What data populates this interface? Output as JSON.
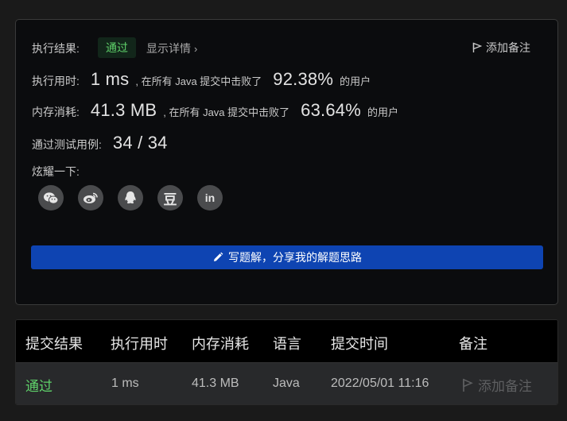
{
  "result": {
    "label": "执行结果:",
    "status": "通过",
    "detail_link": "显示详情",
    "add_note": "添加备注"
  },
  "runtime": {
    "label": "执行用时:",
    "value": "1 ms",
    "mid": ", 在所有 Java 提交中击败了",
    "percent": "92.38%",
    "suffix": "的用户"
  },
  "memory": {
    "label": "内存消耗:",
    "value": "41.3 MB",
    "mid": ", 在所有 Java 提交中击败了",
    "percent": "63.64%",
    "suffix": "的用户"
  },
  "tests": {
    "label": "通过测试用例:",
    "value": "34 / 34"
  },
  "share": {
    "label": "炫耀一下:",
    "icons": [
      "wechat-icon",
      "weibo-icon",
      "qq-icon",
      "douban-icon",
      "linkedin-icon"
    ],
    "douban_glyph": "豆",
    "linkedin_glyph": "in"
  },
  "write_button": "写题解，分享我的解题思路",
  "table": {
    "headers": [
      "提交结果",
      "执行用时",
      "内存消耗",
      "语言",
      "提交时间",
      "备注"
    ],
    "row": {
      "result": "通过",
      "runtime": "1 ms",
      "memory": "41.3 MB",
      "language": "Java",
      "time": "2022/05/01 11:16",
      "note": "添加备注"
    }
  },
  "colors": {
    "pass": "#5fd16a",
    "button": "#0e44b2",
    "card_bg": "#0b0c0e"
  }
}
